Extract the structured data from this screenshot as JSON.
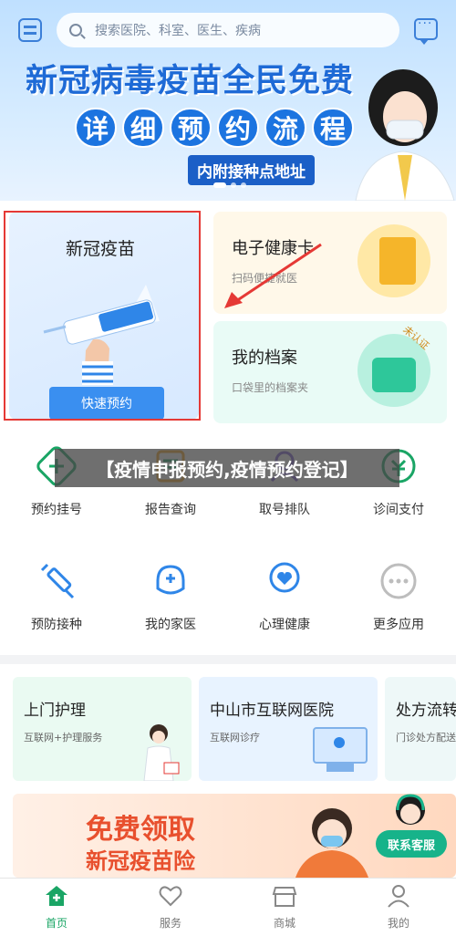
{
  "search": {
    "placeholder": "搜索医院、科室、医生、疾病"
  },
  "banner": {
    "title": "新冠病毒疫苗全民免费",
    "steps": [
      "详",
      "细",
      "预",
      "约",
      "流",
      "程"
    ],
    "subtitle": "内附接种点地址"
  },
  "cards": {
    "vaccine": {
      "title": "新冠疫苗",
      "button": "快速预约"
    },
    "health_card": {
      "title": "电子健康卡",
      "subtitle": "扫码便捷就医"
    },
    "archive": {
      "title": "我的档案",
      "subtitle": "口袋里的档案夹",
      "tag": "未认证"
    }
  },
  "caption": "【疫情申报预约,疫情预约登记】",
  "grid": [
    {
      "label": "预约挂号",
      "icon": "hospital-cross-icon"
    },
    {
      "label": "报告查询",
      "icon": "report-icon"
    },
    {
      "label": "取号排队",
      "icon": "queue-icon"
    },
    {
      "label": "诊间支付",
      "icon": "payment-icon"
    },
    {
      "label": "预防接种",
      "icon": "syringe-icon"
    },
    {
      "label": "我的家医",
      "icon": "doctor-icon"
    },
    {
      "label": "心理健康",
      "icon": "heart-new-icon"
    },
    {
      "label": "更多应用",
      "icon": "more-icon"
    }
  ],
  "services": [
    {
      "title": "上门护理",
      "subtitle": "互联网+护理服务"
    },
    {
      "title": "中山市互联网医院",
      "subtitle": "互联网诊疗"
    },
    {
      "title": "处方流转",
      "subtitle": "门诊处方配送"
    }
  ],
  "promo": {
    "title": "免费领取",
    "subtitle": "新冠疫苗险",
    "cs_button": "联系客服"
  },
  "nav": [
    {
      "label": "首页",
      "icon": "home-icon",
      "active": true
    },
    {
      "label": "服务",
      "icon": "heart-icon",
      "active": false
    },
    {
      "label": "商城",
      "icon": "shop-icon",
      "active": false
    },
    {
      "label": "我的",
      "icon": "user-icon",
      "active": false
    }
  ],
  "colors": {
    "accent": "#1aa565",
    "brand_blue": "#1e6ad6",
    "highlight_red": "#e53935"
  }
}
